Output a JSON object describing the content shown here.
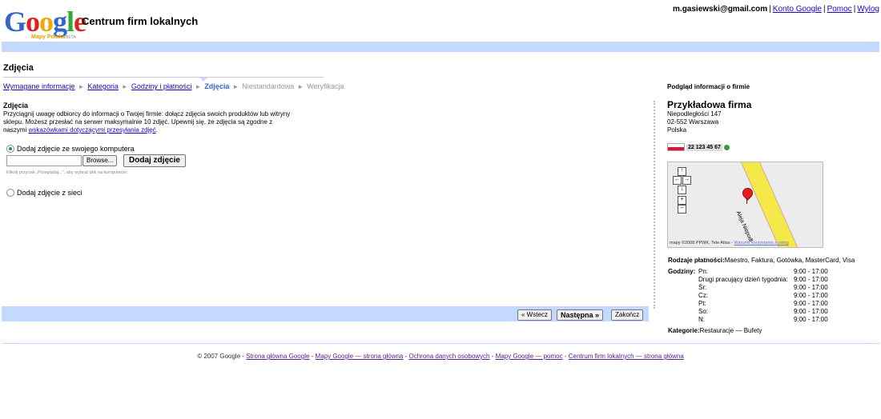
{
  "header": {
    "logo_text": "Google",
    "logo_sub": "Mapy Polska",
    "logo_beta": "BETA",
    "app_title": "Centrum firm lokalnych",
    "user_email": "m.gasiewski@gmail.com",
    "links": [
      "Konto Google",
      "Pomoc",
      "Wylog"
    ]
  },
  "page": {
    "title": "Zdjęcia",
    "steps": [
      {
        "label": "Wymagane informacje"
      },
      {
        "label": "Kategoria"
      },
      {
        "label": "Godziny i płatności"
      },
      {
        "label": "Zdjęcia"
      },
      {
        "label": "Niestandardowa"
      },
      {
        "label": "Weryfikacja"
      }
    ],
    "section_title": "Zdjęcia",
    "section_desc": "Przyciągnij uwagę odbiorcy do informacji o Twojej firmie: dołącz zdjęcia swoich produktów lub witryny sklepu. Możesz przesłać na serwer maksymalnie 10 zdjęć. Upewnij się, że zdjęcia są zgodne z naszymi",
    "section_link": "wskazówkami dotyczącymi przesyłania zdjęć",
    "option_computer": "Dodaj zdjęcie ze swojego komputera",
    "browse_label": "Browse...",
    "add_photo_label": "Dodaj zdjęcie",
    "hint": "Kliknij przycisk „Przeglądaj...\", aby wybrać plik na komputerze.",
    "option_web": "Dodaj zdjęcie z sieci",
    "back_label": "« Wstecz",
    "next_label": "Następna »",
    "finish_label": "Zakończ"
  },
  "preview": {
    "heading": "Podgląd informacji o firmie",
    "business_name": "Przykładowa firma",
    "address_lines": [
      "Niepodległości 147",
      "02-552 Warszawa",
      "Polska"
    ],
    "phone": "22 123 45 67",
    "map_road_label": "Aleja Niepodl",
    "map_attribution": "mapy ©2008 PPWK, Tele Atlas -",
    "map_terms_link": "Warunki korzystania z usług",
    "payments_label": "Rodzaje płatności:",
    "payments_value": "Maestro, Faktura, Gotówka, MasterCard, Visa",
    "hours_label": "Godziny:",
    "hours": [
      {
        "day": "Pn:",
        "time": "9:00 - 17:00"
      },
      {
        "day": "Drugi pracujący dzień tygodnia:",
        "time": "9:00 - 17:00"
      },
      {
        "day": "Śr:",
        "time": "9:00 - 17:00"
      },
      {
        "day": "Cz:",
        "time": "9:00 - 17:00"
      },
      {
        "day": "Pt:",
        "time": "9:00 - 17:00"
      },
      {
        "day": "So:",
        "time": "9:00 - 17:00"
      },
      {
        "day": "N:",
        "time": "9:00 - 17:00"
      }
    ],
    "categories_label": "Kategorie:",
    "categories_value": "Restauracje — Bufety"
  },
  "footer": {
    "copyright": "© 2007 Google",
    "links": [
      "Strona główna Google",
      "Mapy Google — strona główna",
      "Ochrona danych osobowych",
      "Mapy Google — pomoc",
      "Centrum firm lokalnych — strona główna"
    ]
  },
  "colors": {
    "bar_blue": "#c3d9ff",
    "link": "#2200cc",
    "step_current": "#3366cc"
  }
}
